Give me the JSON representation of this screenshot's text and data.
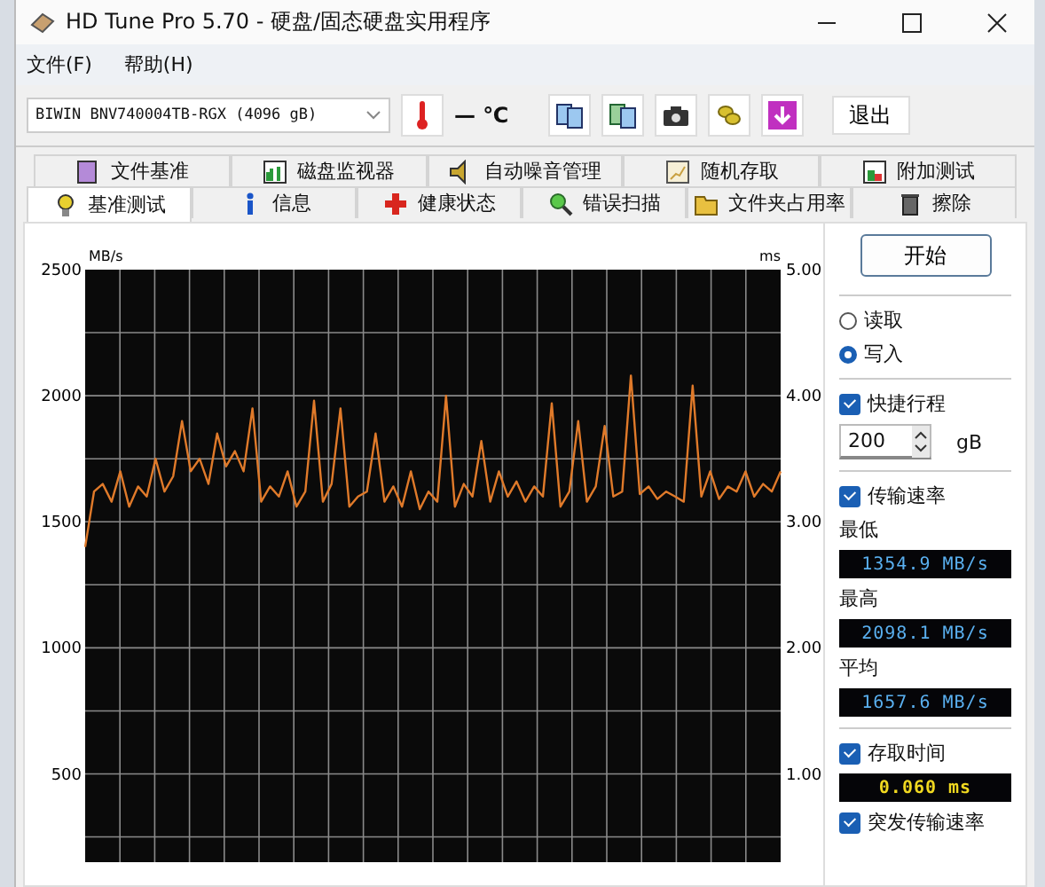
{
  "window": {
    "title": "HD Tune Pro 5.70 - 硬盘/固态硬盘实用程序"
  },
  "menu": [
    "文件(F)",
    "帮助(H)"
  ],
  "toolbar": {
    "drive": "BIWIN BNV740004TB-RGX (4096 gB)",
    "temperature": "— ℃",
    "exit": "退出"
  },
  "tabs_top": [
    {
      "label": "文件基准",
      "selected": false
    },
    {
      "label": "磁盘监视器",
      "selected": false
    },
    {
      "label": "自动噪音管理",
      "selected": false
    },
    {
      "label": "随机存取",
      "selected": false
    },
    {
      "label": "附加测试",
      "selected": false
    }
  ],
  "tabs_bottom": [
    {
      "label": "基准测试",
      "selected": true
    },
    {
      "label": "信息",
      "selected": false
    },
    {
      "label": "健康状态",
      "selected": false
    },
    {
      "label": "错误扫描",
      "selected": false
    },
    {
      "label": "文件夹占用率",
      "selected": false
    },
    {
      "label": "擦除",
      "selected": false
    }
  ],
  "chart": {
    "right_unit": "ms",
    "right_ticks": [
      "5.00",
      "4.00",
      "3.00",
      "2.00",
      "1.00"
    ],
    "chart_data": {
      "type": "line",
      "grid": true,
      "ylabel": "MB/s",
      "ylim": [
        150,
        2500
      ],
      "yticks": [
        500,
        1000,
        1500,
        2000,
        2500
      ],
      "series": [
        {
          "color": "#e07a2a",
          "values": [
            1400,
            1620,
            1650,
            1580,
            1700,
            1560,
            1640,
            1600,
            1750,
            1620,
            1680,
            1900,
            1700,
            1750,
            1650,
            1850,
            1720,
            1780,
            1700,
            1950,
            1580,
            1640,
            1600,
            1700,
            1560,
            1620,
            1980,
            1580,
            1650,
            1950,
            1560,
            1600,
            1620,
            1850,
            1580,
            1640,
            1560,
            1700,
            1550,
            1620,
            1580,
            2000,
            1560,
            1650,
            1600,
            1820,
            1580,
            1700,
            1600,
            1660,
            1580,
            1640,
            1600,
            1970,
            1560,
            1620,
            1900,
            1580,
            1640,
            1880,
            1600,
            1620,
            2080,
            1610,
            1640,
            1590,
            1620,
            1600,
            1580,
            2040,
            1600,
            1700,
            1590,
            1640,
            1620,
            1700,
            1600,
            1650,
            1620,
            1700
          ]
        }
      ]
    }
  },
  "panel": {
    "start": "开始",
    "modes": [
      {
        "label": "读取",
        "selected": false
      },
      {
        "label": "写入",
        "selected": true
      }
    ],
    "short_stroke": {
      "label": "快捷行程",
      "checked": true,
      "value": "200",
      "unit": "gB"
    },
    "transfer": {
      "label": "传输速率",
      "checked": true
    },
    "stats": [
      {
        "label": "最低",
        "value": "1354.9 MB/s"
      },
      {
        "label": "最高",
        "value": "2098.1 MB/s"
      },
      {
        "label": "平均",
        "value": "1657.6 MB/s"
      }
    ],
    "access": {
      "label": "存取时间",
      "checked": true,
      "value": "0.060 ms"
    },
    "burst": {
      "label": "突发传输速率",
      "checked": true
    }
  }
}
